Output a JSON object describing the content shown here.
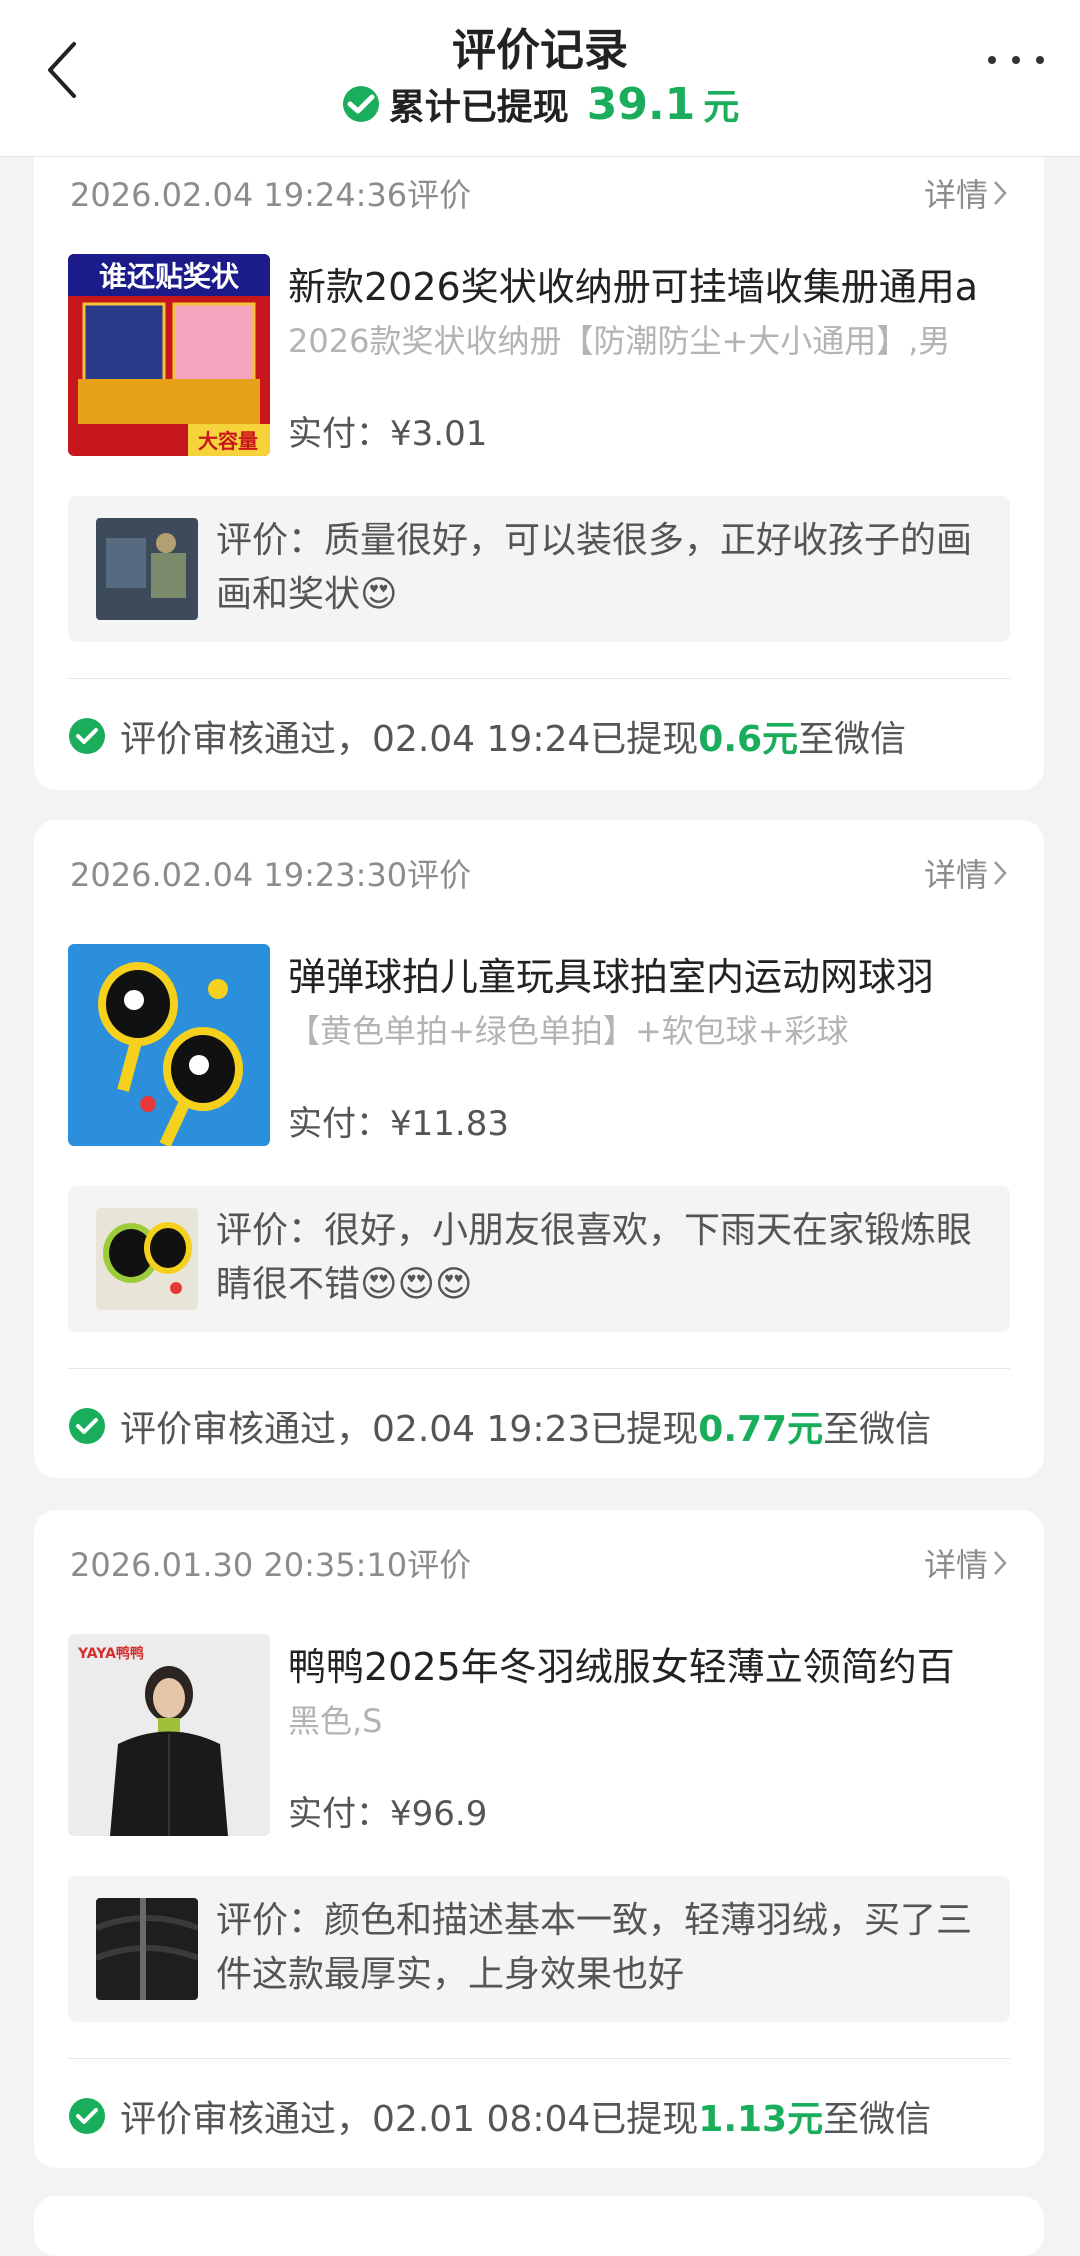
{
  "header": {
    "title": "评价记录",
    "subtitle_label": "累计已提现",
    "total_amount": "39.1",
    "total_unit": "元"
  },
  "common": {
    "detail_label": "详情",
    "paid_prefix": "实付：",
    "review_prefix": "评价：",
    "status_prefix": "评价审核通过，",
    "withdrawn_label": "已提现",
    "to_wechat": "至微信"
  },
  "records": [
    {
      "time": "2026.02.04 19:24:36评价",
      "product_name": "新款2026奖状收纳册可挂墙收集册通用a",
      "spec": "2026款奖状收纳册【防潮防尘+大小通用】,男",
      "paid": "¥3.01",
      "review": "质量很好，可以装很多，正好收孩子的画画和奖状😍",
      "status_time": "02.04 19:24",
      "cash": "0.6元",
      "thumb_text_top": "谁还贴奖状",
      "thumb_text_bottom": "大容量"
    },
    {
      "time": "2026.02.04 19:23:30评价",
      "product_name": "弹弹球拍儿童玩具球拍室内运动网球羽",
      "spec": "【黄色单拍+绿色单拍】+软包球+彩球",
      "paid": "¥11.83",
      "review": "很好，小朋友很喜欢，下雨天在家锻炼眼睛很不错😍😍😍",
      "status_time": "02.04 19:23",
      "cash": "0.77元"
    },
    {
      "time": "2026.01.30 20:35:10评价",
      "product_name": "鸭鸭2025年冬羽绒服女轻薄立领简约百",
      "spec": "黑色,S",
      "paid": "¥96.9",
      "review": "颜色和描述基本一致，轻薄羽绒，买了三件这款最厚实，上身效果也好",
      "status_time": "02.01 08:04",
      "cash": "1.13元",
      "thumb_text_top": "YAYA鸭鸭"
    }
  ]
}
